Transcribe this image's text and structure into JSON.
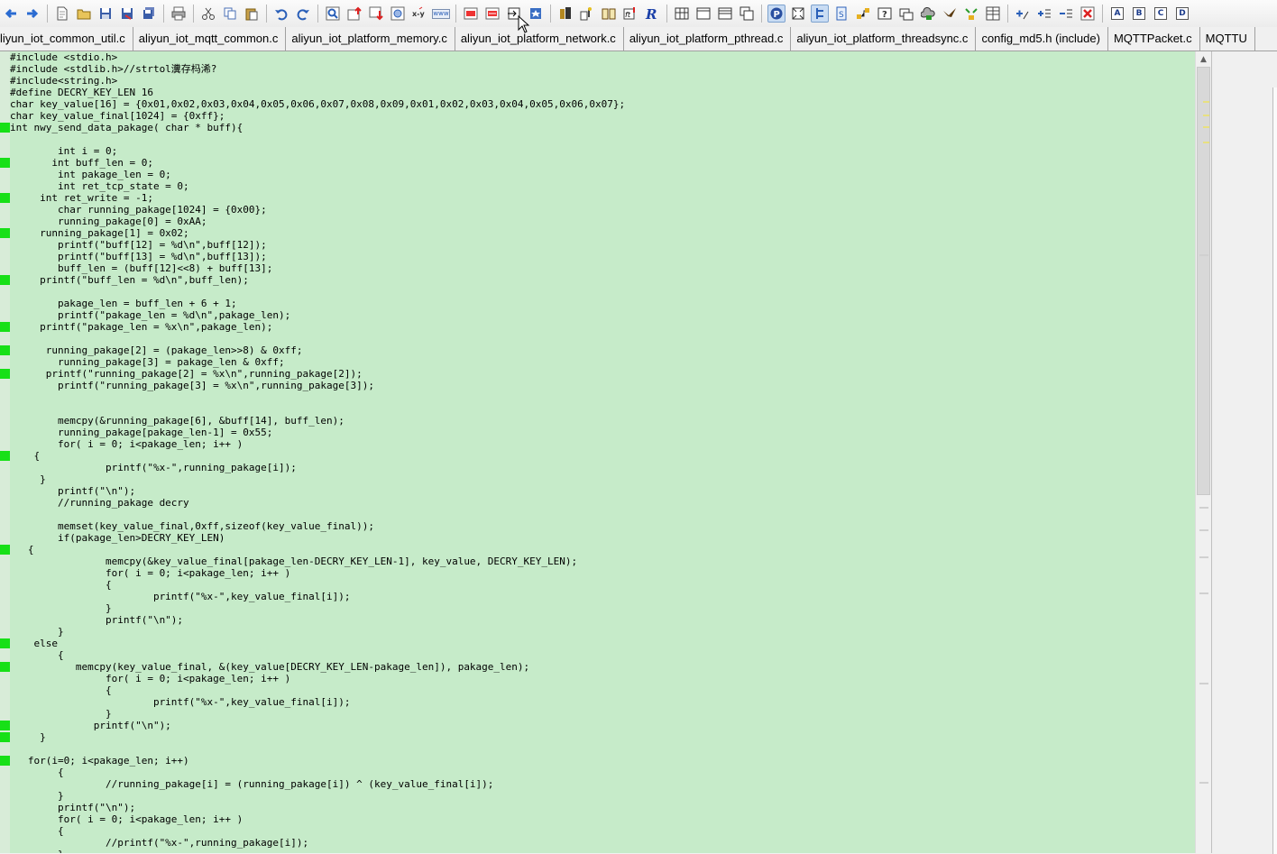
{
  "toolbar": {
    "buttons": [
      "back-arrow-icon",
      "forward-arrow-icon",
      "sep",
      "new-file-icon",
      "open-folder-icon",
      "save-icon",
      "save-as-icon",
      "save-all-icon",
      "sep",
      "print-icon",
      "sep",
      "cut-icon",
      "copy-icon",
      "paste-icon",
      "sep",
      "undo-icon",
      "redo-icon",
      "sep",
      "find-icon",
      "jump-up-icon",
      "jump-down-icon",
      "find-in-files-icon",
      "replace-icon",
      "web-icon",
      "sep",
      "bookmark-toggle-icon",
      "bookmark-prev-icon",
      "bookmark-next-icon",
      "bookmark-list-icon",
      "sep",
      "relation-icon",
      "symbol-icon",
      "book-icon",
      "function-icon",
      "r-icon",
      "sep",
      "layout-grid-icon",
      "window-single-icon",
      "window-split-icon",
      "window-cascade-icon",
      "sep",
      "project-icon",
      "context-icon",
      "tree-icon",
      "doc-icon",
      "branch-icon",
      "help-icon",
      "chat-icon",
      "cloud-icon",
      "bird-icon",
      "sync-icon",
      "table-icon",
      "sep",
      "add-line-icon",
      "add-item-icon",
      "remove-item-icon",
      "close-red-icon",
      "sep",
      "a-icon",
      "b-icon",
      "c-icon",
      "d-icon"
    ],
    "text_icons": {
      "web-icon": "www",
      "a-icon": "A",
      "b-icon": "B",
      "c-icon": "C",
      "d-icon": "D"
    },
    "pressed": [
      "project-icon",
      "tree-icon"
    ]
  },
  "tabs": [
    "liyun_iot_common_util.c",
    "aliyun_iot_mqtt_common.c",
    "aliyun_iot_platform_memory.c",
    "aliyun_iot_platform_network.c",
    "aliyun_iot_platform_pthread.c",
    "aliyun_iot_platform_threadsync.c",
    "config_md5.h (include)",
    "MQTTPacket.c",
    "MQTTU"
  ],
  "editor": {
    "lines": [
      "#include <stdio.h>",
      "#include <stdlib.h>//strtol瀵存杩浠?",
      "#include<string.h>",
      "#define DECRY_KEY_LEN 16",
      "char key_value[16] = {0x01,0x02,0x03,0x04,0x05,0x06,0x07,0x08,0x09,0x01,0x02,0x03,0x04,0x05,0x06,0x07};",
      "char key_value_final[1024] = {0xff};",
      "int nwy_send_data_pakage( char * buff){",
      "",
      "        int i = 0;",
      "       int buff_len = 0;",
      "        int pakage_len = 0;",
      "        int ret_tcp_state = 0;",
      "     int ret_write = -1;",
      "        char running_pakage[1024] = {0x00};",
      "        running_pakage[0] = 0xAA;",
      "     running_pakage[1] = 0x02;",
      "        printf(\"buff[12] = %d\\n\",buff[12]);",
      "        printf(\"buff[13] = %d\\n\",buff[13]);",
      "        buff_len = (buff[12]<<8) + buff[13];",
      "     printf(\"buff_len = %d\\n\",buff_len);",
      "",
      "        pakage_len = buff_len + 6 + 1;",
      "        printf(\"pakage_len = %d\\n\",pakage_len);",
      "     printf(\"pakage_len = %x\\n\",pakage_len);",
      "",
      "      running_pakage[2] = (pakage_len>>8) & 0xff;",
      "        running_pakage[3] = pakage_len & 0xff;",
      "      printf(\"running_pakage[2] = %x\\n\",running_pakage[2]);",
      "        printf(\"running_pakage[3] = %x\\n\",running_pakage[3]);",
      "",
      "",
      "        memcpy(&running_pakage[6], &buff[14], buff_len);",
      "        running_pakage[pakage_len-1] = 0x55;",
      "        for( i = 0; i<pakage_len; i++ )",
      "    {",
      "                printf(\"%x-\",running_pakage[i]);",
      "     }",
      "        printf(\"\\n\");",
      "        //running_pakage decry",
      "",
      "        memset(key_value_final,0xff,sizeof(key_value_final));",
      "        if(pakage_len>DECRY_KEY_LEN)",
      "   {",
      "                memcpy(&key_value_final[pakage_len-DECRY_KEY_LEN-1], key_value, DECRY_KEY_LEN);",
      "                for( i = 0; i<pakage_len; i++ )",
      "                {",
      "                        printf(\"%x-\",key_value_final[i]);",
      "                }",
      "                printf(\"\\n\");",
      "        }",
      "    else",
      "        {",
      "           memcpy(key_value_final, &(key_value[DECRY_KEY_LEN-pakage_len]), pakage_len);",
      "                for( i = 0; i<pakage_len; i++ )",
      "                {",
      "                        printf(\"%x-\",key_value_final[i]);",
      "                }",
      "              printf(\"\\n\");",
      "     }",
      "",
      "   for(i=0; i<pakage_len; i++)",
      "        {",
      "                //running_pakage[i] = (running_pakage[i]) ^ (key_value_final[i]);",
      "        }",
      "        printf(\"\\n\");",
      "        for( i = 0; i<pakage_len; i++ )",
      "        {",
      "                //printf(\"%x-\",running_pakage[i]);",
      "        }"
    ],
    "changed_lines": [
      6,
      9,
      12,
      15,
      19,
      23,
      25,
      27,
      34,
      42,
      50,
      52,
      57,
      58,
      60
    ]
  },
  "colors": {
    "editor_bg": "#c6ebc9",
    "change_marker": "#17e017"
  }
}
